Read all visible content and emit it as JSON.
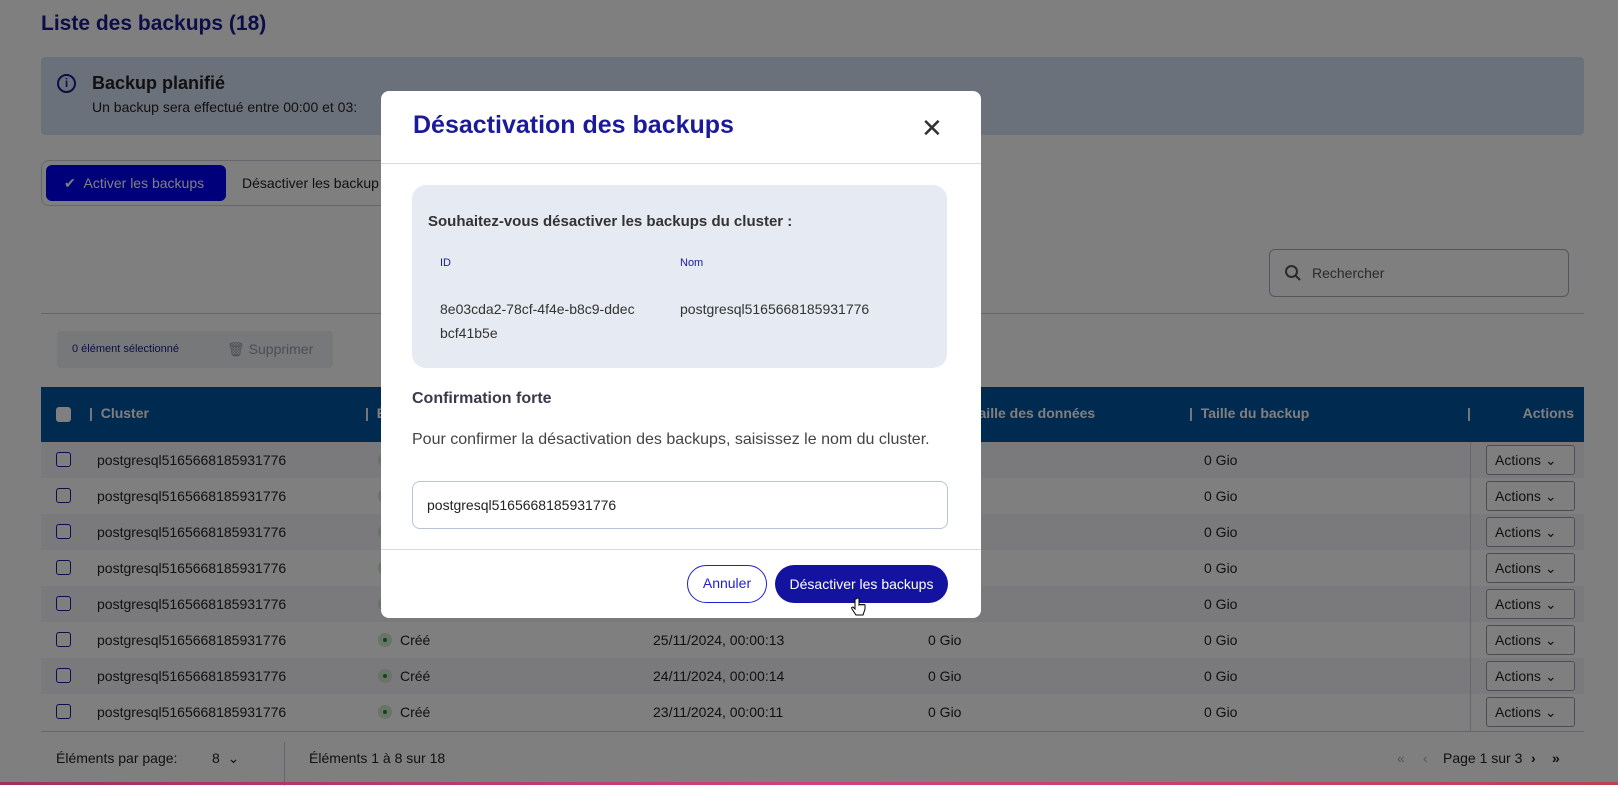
{
  "page": {
    "title": "Liste des backups (18)"
  },
  "banner": {
    "icon": "info-icon",
    "title": "Backup planifié",
    "text": "Un backup sera effectué entre 00:00 et 03:"
  },
  "toolbar": {
    "enable_label": "Activer les backups",
    "disable_label": "Désactiver les backup"
  },
  "search": {
    "placeholder": "Rechercher"
  },
  "selection": {
    "count_label": "0 élément sélectionné",
    "delete_label": "Supprimer"
  },
  "table": {
    "headers": {
      "cluster": "Cluster",
      "state": "État",
      "date": "",
      "data_size": "Taille des données",
      "backup_size": "Taille du backup",
      "actions": "Actions"
    },
    "rows": [
      {
        "cluster": "postgresql5165668185931776",
        "state": "",
        "date": "",
        "data_size": "",
        "backup_size": "0 Gio",
        "action": "Actions"
      },
      {
        "cluster": "postgresql5165668185931776",
        "state": "",
        "date": "",
        "data_size": "",
        "backup_size": "0 Gio",
        "action": "Actions"
      },
      {
        "cluster": "postgresql5165668185931776",
        "state": "",
        "date": "",
        "data_size": "",
        "backup_size": "0 Gio",
        "action": "Actions"
      },
      {
        "cluster": "postgresql5165668185931776",
        "state": "",
        "date": "",
        "data_size": "",
        "backup_size": "0 Gio",
        "action": "Actions"
      },
      {
        "cluster": "postgresql5165668185931776",
        "state": "",
        "date": "",
        "data_size": "",
        "backup_size": "0 Gio",
        "action": "Actions"
      },
      {
        "cluster": "postgresql5165668185931776",
        "state": "Créé",
        "date": "25/11/2024, 00:00:13",
        "data_size": "0 Gio",
        "backup_size": "0 Gio",
        "action": "Actions"
      },
      {
        "cluster": "postgresql5165668185931776",
        "state": "Créé",
        "date": "24/11/2024, 00:00:14",
        "data_size": "0 Gio",
        "backup_size": "0 Gio",
        "action": "Actions"
      },
      {
        "cluster": "postgresql5165668185931776",
        "state": "Créé",
        "date": "23/11/2024, 00:00:11",
        "data_size": "0 Gio",
        "backup_size": "0 Gio",
        "action": "Actions"
      }
    ]
  },
  "pagination": {
    "per_page_label": "Éléments par page:",
    "per_page": "8",
    "range": "Éléments 1 à 8 sur 18",
    "page": "Page 1 sur 3"
  },
  "modal": {
    "title": "Désactivation des backups",
    "question": "Souhaitez-vous désactiver les backups du cluster :",
    "id_label": "ID",
    "id_value": "8e03cda2-78cf-4f4e-b8c9-ddecbcf41b5e",
    "name_label": "Nom",
    "name_value": "postgresql5165668185931776",
    "confirm_title": "Confirmation forte",
    "confirm_text": "Pour confirmer la désactivation des backups, saisissez le nom du cluster.",
    "input_value": "postgresql5165668185931776",
    "cancel_label": "Annuler",
    "confirm_label": "Désactiver les backups"
  },
  "colors": {
    "primary": "#1b1b9a",
    "table_header": "#0055a0",
    "success": "#2a8a2a"
  }
}
